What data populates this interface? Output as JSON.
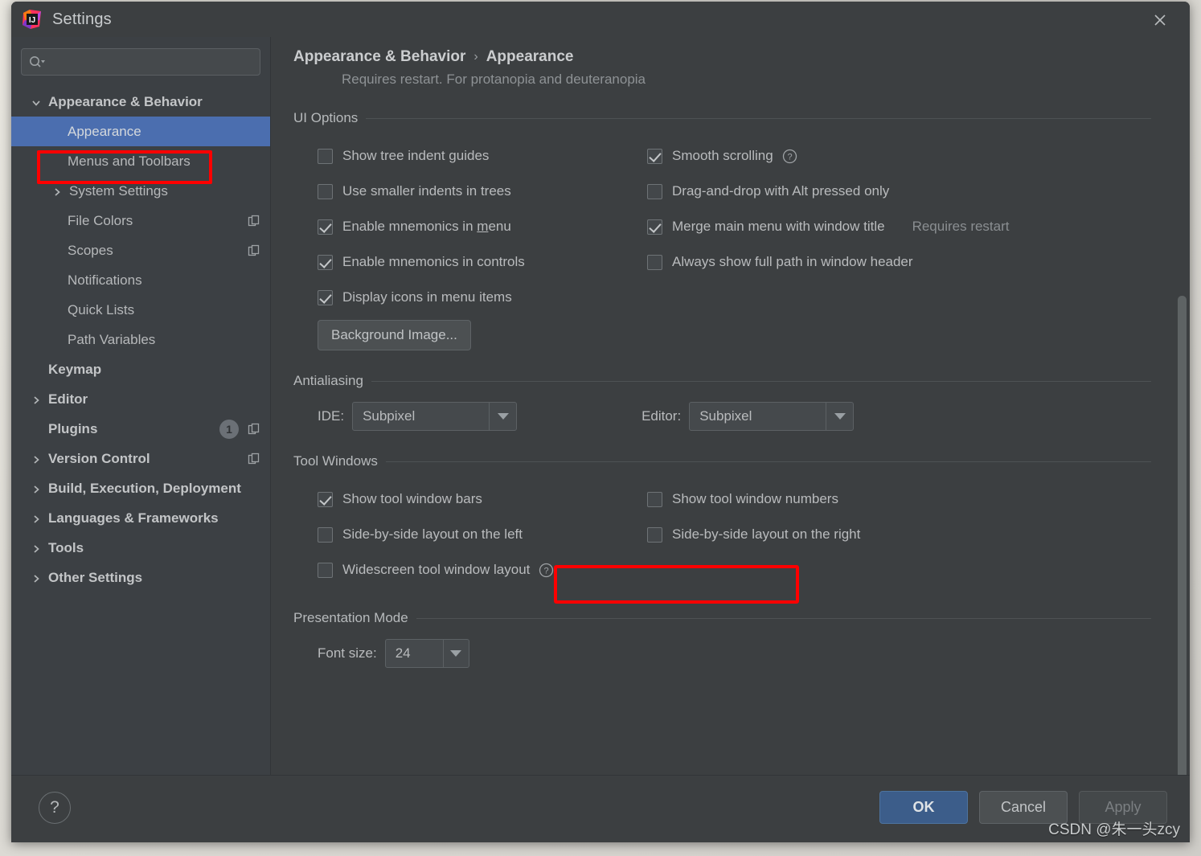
{
  "window": {
    "title": "Settings",
    "app_icon": "intellij-idea-icon",
    "close_icon": "close-icon"
  },
  "sidebar": {
    "search": {
      "placeholder": "",
      "value": "",
      "icon": "search-icon"
    },
    "items": [
      {
        "label": "Appearance & Behavior",
        "arrow": "down",
        "bold": true,
        "indent": 0,
        "selected": false
      },
      {
        "label": "Appearance",
        "arrow": "none",
        "bold": false,
        "indent": 1,
        "selected": true
      },
      {
        "label": "Menus and Toolbars",
        "arrow": "none",
        "bold": false,
        "indent": 1,
        "selected": false
      },
      {
        "label": "System Settings",
        "arrow": "right",
        "bold": false,
        "indent": 1,
        "selected": false
      },
      {
        "label": "File Colors",
        "arrow": "none",
        "bold": false,
        "indent": 1,
        "selected": false,
        "copy_icon": true
      },
      {
        "label": "Scopes",
        "arrow": "none",
        "bold": false,
        "indent": 1,
        "selected": false,
        "copy_icon": true
      },
      {
        "label": "Notifications",
        "arrow": "none",
        "bold": false,
        "indent": 1,
        "selected": false
      },
      {
        "label": "Quick Lists",
        "arrow": "none",
        "bold": false,
        "indent": 1,
        "selected": false
      },
      {
        "label": "Path Variables",
        "arrow": "none",
        "bold": false,
        "indent": 1,
        "selected": false
      },
      {
        "label": "Keymap",
        "arrow": "none",
        "bold": true,
        "indent": 0,
        "selected": false
      },
      {
        "label": "Editor",
        "arrow": "right",
        "bold": true,
        "indent": 0,
        "selected": false
      },
      {
        "label": "Plugins",
        "arrow": "none",
        "bold": true,
        "indent": 0,
        "selected": false,
        "badge": "1",
        "copy_icon": true
      },
      {
        "label": "Version Control",
        "arrow": "right",
        "bold": true,
        "indent": 0,
        "selected": false,
        "copy_icon": true
      },
      {
        "label": "Build, Execution, Deployment",
        "arrow": "right",
        "bold": true,
        "indent": 0,
        "selected": false
      },
      {
        "label": "Languages & Frameworks",
        "arrow": "right",
        "bold": true,
        "indent": 0,
        "selected": false
      },
      {
        "label": "Tools",
        "arrow": "right",
        "bold": true,
        "indent": 0,
        "selected": false
      },
      {
        "label": "Other Settings",
        "arrow": "right",
        "bold": true,
        "indent": 0,
        "selected": false
      }
    ]
  },
  "main": {
    "breadcrumb": {
      "parent": "Appearance & Behavior",
      "separator": "›",
      "current": "Appearance"
    },
    "note": "Requires restart. For protanopia and deuteranopia",
    "sections": {
      "ui_options": {
        "title": "UI Options",
        "left": [
          {
            "label": "Show tree indent guides",
            "checked": false
          },
          {
            "label": "Use smaller indents in trees",
            "checked": false
          },
          {
            "label": "Enable mnemonics in menu",
            "checked": true,
            "mnemonic": "m"
          },
          {
            "label": "Enable mnemonics in controls",
            "checked": true
          },
          {
            "label": "Display icons in menu items",
            "checked": true
          }
        ],
        "right": [
          {
            "label": "Smooth scrolling",
            "checked": true,
            "help": true
          },
          {
            "label": "Drag-and-drop with Alt pressed only",
            "checked": false
          },
          {
            "label": "Merge main menu with window title",
            "checked": true,
            "note": "Requires restart"
          },
          {
            "label": "Always show full path in window header",
            "checked": false
          }
        ],
        "background_image_button": "Background Image..."
      },
      "antialiasing": {
        "title": "Antialiasing",
        "ide_label": "IDE:",
        "ide_value": "Subpixel",
        "editor_label": "Editor:",
        "editor_value": "Subpixel"
      },
      "tool_windows": {
        "title": "Tool Windows",
        "left": [
          {
            "label": "Show tool window bars",
            "checked": true,
            "highlighted": true
          },
          {
            "label": "Side-by-side layout on the left",
            "checked": false
          },
          {
            "label": "Widescreen tool window layout",
            "checked": false,
            "help": true
          }
        ],
        "right": [
          {
            "label": "Show tool window numbers",
            "checked": false
          },
          {
            "label": "Side-by-side layout on the right",
            "checked": false
          }
        ]
      },
      "presentation_mode": {
        "title": "Presentation Mode",
        "font_size_label": "Font size:",
        "font_size_value": "24"
      }
    }
  },
  "footer": {
    "help_label": "?",
    "ok_label": "OK",
    "cancel_label": "Cancel",
    "apply_label": "Apply"
  },
  "watermark": "CSDN @朱一头zcy",
  "colors": {
    "accent_selection": "#4b6eaf",
    "ok_button": "#3c5d8a",
    "highlight_box": "#ff0000",
    "window_bg": "#3c3f41",
    "sidebar_bg": "#3c4044"
  }
}
